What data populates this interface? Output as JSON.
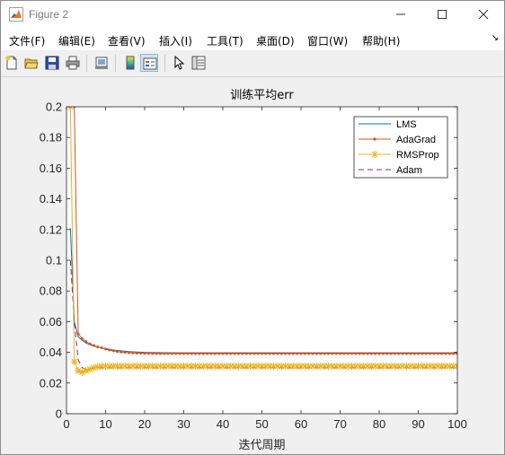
{
  "window": {
    "title": "Figure 2",
    "controls": [
      "minimize-icon",
      "maximize-icon",
      "close-icon"
    ]
  },
  "menubar": {
    "items": [
      {
        "label": "文件(F)"
      },
      {
        "label": "编辑(E)"
      },
      {
        "label": "查看(V)"
      },
      {
        "label": "插入(I)"
      },
      {
        "label": "工具(T)"
      },
      {
        "label": "桌面(D)"
      },
      {
        "label": "窗口(W)"
      },
      {
        "label": "帮助(H)"
      }
    ],
    "dock_arrow": "↘"
  },
  "toolbar": {
    "icons": [
      "new-figure-icon",
      "open-file-icon",
      "save-icon",
      "print-icon",
      "link-plot-icon",
      "insert-colorbar-icon",
      "insert-legend-icon",
      "pointer-icon",
      "property-inspector-icon"
    ]
  },
  "colors": {
    "LMS": "#0072bd",
    "AdaGrad": "#d95319",
    "RMSProp": "#edb120",
    "Adam": "#7e2f8e"
  },
  "chart_data": {
    "type": "line",
    "title": "训练平均err",
    "xlabel": "迭代周期",
    "ylabel": "",
    "xlim": [
      0,
      100
    ],
    "ylim": [
      0,
      0.2
    ],
    "xticks": [
      0,
      10,
      20,
      30,
      40,
      50,
      60,
      70,
      80,
      90,
      100
    ],
    "yticks": [
      0,
      0.02,
      0.04,
      0.06,
      0.08,
      0.1,
      0.12,
      0.14,
      0.16,
      0.18,
      0.2
    ],
    "grid": false,
    "legend_position": "top-right",
    "series": [
      {
        "name": "LMS",
        "marker": "none",
        "dash": "solid",
        "x": [
          1,
          2,
          3,
          4,
          5,
          6,
          7,
          8,
          9,
          10,
          12,
          14,
          16,
          18,
          20,
          25,
          30,
          40,
          50,
          60,
          70,
          80,
          90,
          100
        ],
        "y": [
          0.121,
          0.06,
          0.05,
          0.048,
          0.046,
          0.045,
          0.044,
          0.0435,
          0.043,
          0.0425,
          0.0415,
          0.041,
          0.0405,
          0.0402,
          0.04,
          0.0398,
          0.0397,
          0.0397,
          0.0397,
          0.0397,
          0.0397,
          0.0397,
          0.0397,
          0.0397
        ]
      },
      {
        "name": "AdaGrad",
        "marker": "dot",
        "dash": "solid",
        "x": [
          1,
          2,
          3,
          4,
          5,
          6,
          7,
          8,
          9,
          10,
          11,
          12,
          13,
          14,
          15,
          16,
          17,
          18,
          19,
          20,
          21,
          22,
          23,
          24,
          25,
          26,
          27,
          28,
          29,
          30,
          31,
          32,
          33,
          34,
          35,
          36,
          37,
          38,
          39,
          40,
          41,
          42,
          43,
          44,
          45,
          46,
          47,
          48,
          49,
          50,
          51,
          52,
          53,
          54,
          55,
          56,
          57,
          58,
          59,
          60,
          61,
          62,
          63,
          64,
          65,
          66,
          67,
          68,
          69,
          70,
          71,
          72,
          73,
          74,
          75,
          76,
          77,
          78,
          79,
          80,
          81,
          82,
          83,
          84,
          85,
          86,
          87,
          88,
          89,
          90,
          91,
          92,
          93,
          94,
          95,
          96,
          97,
          98,
          99,
          100
        ],
        "y": [
          0.2,
          0.2,
          0.052,
          0.049,
          0.047,
          0.0455,
          0.0445,
          0.0435,
          0.043,
          0.0422,
          0.0415,
          0.041,
          0.0405,
          0.0402,
          0.04,
          0.0398,
          0.0396,
          0.0395,
          0.0394,
          0.0393,
          0.0393,
          0.0392,
          0.0392,
          0.0392,
          0.0392,
          0.0392,
          0.0392,
          0.0392,
          0.0392,
          0.0392,
          0.0392,
          0.0392,
          0.0392,
          0.0392,
          0.0392,
          0.0392,
          0.0392,
          0.0392,
          0.0392,
          0.0392,
          0.0392,
          0.0392,
          0.0392,
          0.0392,
          0.0392,
          0.0392,
          0.0392,
          0.0392,
          0.0392,
          0.0392,
          0.0392,
          0.0392,
          0.0392,
          0.0392,
          0.0392,
          0.0392,
          0.0392,
          0.0392,
          0.0392,
          0.0392,
          0.0392,
          0.0392,
          0.0392,
          0.0392,
          0.0392,
          0.0392,
          0.0392,
          0.0392,
          0.0392,
          0.0392,
          0.0392,
          0.0392,
          0.0392,
          0.0392,
          0.0392,
          0.0392,
          0.0392,
          0.0392,
          0.0392,
          0.0392,
          0.0392,
          0.0392,
          0.0392,
          0.0392,
          0.0392,
          0.0392,
          0.0392,
          0.0392,
          0.0392,
          0.0392,
          0.0392,
          0.0392,
          0.0392,
          0.0392,
          0.0392,
          0.0392,
          0.0392,
          0.0392,
          0.0392,
          0.0392
        ]
      },
      {
        "name": "RMSProp",
        "marker": "asterisk",
        "dash": "solid",
        "x": [
          1,
          2,
          3,
          4,
          5,
          6,
          7,
          8,
          9,
          10,
          11,
          12,
          13,
          14,
          15,
          16,
          17,
          18,
          19,
          20,
          21,
          22,
          23,
          24,
          25,
          26,
          27,
          28,
          29,
          30,
          31,
          32,
          33,
          34,
          35,
          36,
          37,
          38,
          39,
          40,
          41,
          42,
          43,
          44,
          45,
          46,
          47,
          48,
          49,
          50,
          51,
          52,
          53,
          54,
          55,
          56,
          57,
          58,
          59,
          60,
          61,
          62,
          63,
          64,
          65,
          66,
          67,
          68,
          69,
          70,
          71,
          72,
          73,
          74,
          75,
          76,
          77,
          78,
          79,
          80,
          81,
          82,
          83,
          84,
          85,
          86,
          87,
          88,
          89,
          90,
          91,
          92,
          93,
          94,
          95,
          96,
          97,
          98,
          99,
          100
        ],
        "y": [
          0.2,
          0.034,
          0.028,
          0.027,
          0.028,
          0.029,
          0.03,
          0.0305,
          0.031,
          0.031,
          0.031,
          0.031,
          0.031,
          0.031,
          0.031,
          0.031,
          0.031,
          0.031,
          0.031,
          0.031,
          0.031,
          0.031,
          0.031,
          0.031,
          0.031,
          0.031,
          0.031,
          0.031,
          0.031,
          0.031,
          0.031,
          0.031,
          0.031,
          0.031,
          0.031,
          0.031,
          0.031,
          0.031,
          0.031,
          0.031,
          0.031,
          0.031,
          0.031,
          0.031,
          0.031,
          0.031,
          0.031,
          0.031,
          0.031,
          0.031,
          0.031,
          0.031,
          0.031,
          0.031,
          0.031,
          0.031,
          0.031,
          0.031,
          0.031,
          0.031,
          0.031,
          0.031,
          0.031,
          0.031,
          0.031,
          0.031,
          0.031,
          0.031,
          0.031,
          0.031,
          0.031,
          0.031,
          0.031,
          0.031,
          0.031,
          0.031,
          0.031,
          0.031,
          0.031,
          0.031,
          0.031,
          0.031,
          0.031,
          0.031,
          0.031,
          0.031,
          0.031,
          0.031,
          0.031,
          0.031,
          0.031,
          0.031,
          0.031,
          0.031,
          0.031,
          0.031,
          0.031,
          0.031,
          0.031,
          0.031
        ]
      },
      {
        "name": "Adam",
        "marker": "none",
        "dash": "dashed",
        "x": [
          1,
          2,
          3,
          4,
          5,
          6,
          7,
          8,
          9,
          10,
          12,
          14,
          16,
          18,
          20,
          25,
          30,
          40,
          50,
          60,
          70,
          80,
          90,
          100
        ],
        "y": [
          0.1,
          0.06,
          0.035,
          0.03,
          0.029,
          0.0292,
          0.0295,
          0.0298,
          0.03,
          0.03,
          0.03,
          0.03,
          0.03,
          0.03,
          0.03,
          0.03,
          0.03,
          0.03,
          0.03,
          0.03,
          0.03,
          0.03,
          0.03,
          0.03
        ]
      }
    ]
  }
}
